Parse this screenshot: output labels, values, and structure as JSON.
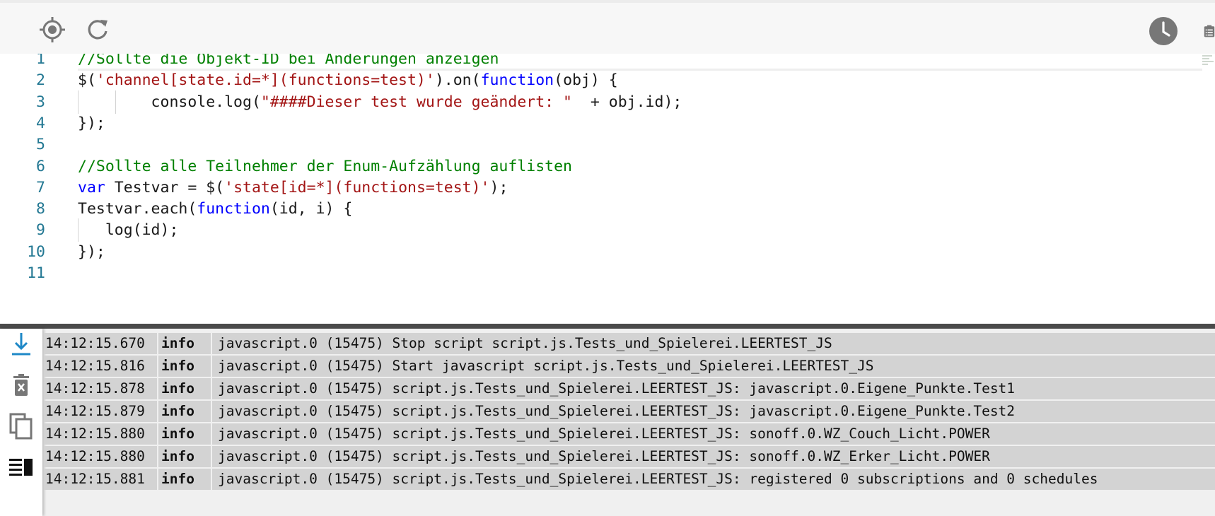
{
  "toolbar": {
    "left_icons": [
      "crosshair-icon",
      "refresh-icon"
    ],
    "right_icons": [
      "clock-icon",
      "clipboard-list-icon"
    ]
  },
  "editor": {
    "lines": [
      {
        "num": "1",
        "tokens": [
          {
            "t": "comment",
            "v": "//Sollte die Objekt-ID bei Änderungen anzeigen"
          }
        ]
      },
      {
        "num": "2",
        "tokens": [
          {
            "t": "plain",
            "v": "$("
          },
          {
            "t": "string",
            "v": "'channel[state.id=*](functions=test)'"
          },
          {
            "t": "plain",
            "v": ").on("
          },
          {
            "t": "keyword",
            "v": "function"
          },
          {
            "t": "plain",
            "v": "(obj) {"
          }
        ]
      },
      {
        "num": "3",
        "tokens": [
          {
            "t": "plain",
            "v": "        console.log("
          },
          {
            "t": "string",
            "v": "\"####Dieser test wurde geändert: \""
          },
          {
            "t": "plain",
            "v": "  + obj.id);"
          }
        ]
      },
      {
        "num": "4",
        "tokens": [
          {
            "t": "plain",
            "v": "});"
          }
        ]
      },
      {
        "num": "5",
        "tokens": []
      },
      {
        "num": "6",
        "tokens": [
          {
            "t": "comment",
            "v": "//Sollte alle Teilnehmer der Enum-Aufzählung auflisten"
          }
        ]
      },
      {
        "num": "7",
        "tokens": [
          {
            "t": "keyword",
            "v": "var"
          },
          {
            "t": "plain",
            "v": " Testvar = $("
          },
          {
            "t": "string",
            "v": "'state[id=*](functions=test)'"
          },
          {
            "t": "plain",
            "v": ");"
          }
        ]
      },
      {
        "num": "8",
        "tokens": [
          {
            "t": "plain",
            "v": "Testvar.each("
          },
          {
            "t": "keyword",
            "v": "function"
          },
          {
            "t": "plain",
            "v": "(id, i) {"
          }
        ]
      },
      {
        "num": "9",
        "tokens": [
          {
            "t": "plain",
            "v": "   log(id);"
          }
        ]
      },
      {
        "num": "10",
        "tokens": [
          {
            "t": "plain",
            "v": "});"
          }
        ]
      },
      {
        "num": "11",
        "tokens": []
      }
    ]
  },
  "log": {
    "side_icons": [
      "scroll-down-icon",
      "clear-log-icon",
      "copy-icon",
      "wrap-lines-icon"
    ],
    "rows": [
      {
        "time": "14:12:15.670",
        "level": "info",
        "msg": "javascript.0 (15475) Stop script script.js.Tests_und_Spielerei.LEERTEST_JS"
      },
      {
        "time": "14:12:15.816",
        "level": "info",
        "msg": "javascript.0 (15475) Start javascript script.js.Tests_und_Spielerei.LEERTEST_JS"
      },
      {
        "time": "14:12:15.878",
        "level": "info",
        "msg": "javascript.0 (15475) script.js.Tests_und_Spielerei.LEERTEST_JS: javascript.0.Eigene_Punkte.Test1"
      },
      {
        "time": "14:12:15.879",
        "level": "info",
        "msg": "javascript.0 (15475) script.js.Tests_und_Spielerei.LEERTEST_JS: javascript.0.Eigene_Punkte.Test2"
      },
      {
        "time": "14:12:15.880",
        "level": "info",
        "msg": "javascript.0 (15475) script.js.Tests_und_Spielerei.LEERTEST_JS: sonoff.0.WZ_Couch_Licht.POWER"
      },
      {
        "time": "14:12:15.880",
        "level": "info",
        "msg": "javascript.0 (15475) script.js.Tests_und_Spielerei.LEERTEST_JS: sonoff.0.WZ_Erker_Licht.POWER"
      },
      {
        "time": "14:12:15.881",
        "level": "info",
        "msg": "javascript.0 (15475) script.js.Tests_und_Spielerei.LEERTEST_JS: registered 0 subscriptions and 0 schedules"
      }
    ]
  },
  "colors": {
    "line_number": "#237893",
    "comment": "#008000",
    "string": "#a31515",
    "keyword": "#0000ff",
    "log_row_bg": "#d3d3d3",
    "accent_blue": "#1e88c7"
  }
}
